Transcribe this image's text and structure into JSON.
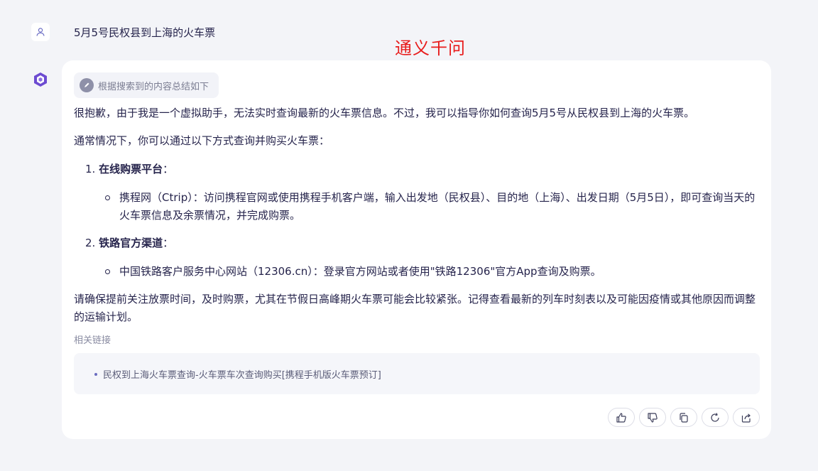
{
  "user": {
    "query": "5月5号民权县到上海的火车票"
  },
  "watermark": "通义千问",
  "response": {
    "summary_chip": "根据搜索到的内容总结如下",
    "para1": "很抱歉，由于我是一个虚拟助手，无法实时查询最新的火车票信息。不过，我可以指导你如何查询5月5号从民权县到上海的火车票。",
    "para2": "通常情况下，你可以通过以下方式查询并购买火车票：",
    "list": [
      {
        "num": "1.",
        "title": "在线购票平台",
        "colon": "：",
        "bullet": "携程网（Ctrip）：访问携程官网或使用携程手机客户端，输入出发地（民权县）、目的地（上海）、出发日期（5月5日），即可查询当天的火车票信息及余票情况，并完成购票。"
      },
      {
        "num": "2.",
        "title": "铁路官方渠道",
        "colon": "：",
        "bullet": "中国铁路客户服务中心网站（12306.cn）：登录官方网站或者使用\"铁路12306\"官方App查询及购票。"
      }
    ],
    "para3": "请确保提前关注放票时间，及时购票，尤其在节假日高峰期火车票可能会比较紧张。记得查看最新的列车时刻表以及可能因疫情或其他原因而调整的运输计划。",
    "related_label": "相关链接",
    "related_links": [
      "民权到上海火车票查询-火车票车次查询购买[携程手机版火车票预订]"
    ]
  },
  "actions": [
    "thumbs-up-icon",
    "thumbs-down-icon",
    "copy-icon",
    "regenerate-icon",
    "share-icon"
  ]
}
